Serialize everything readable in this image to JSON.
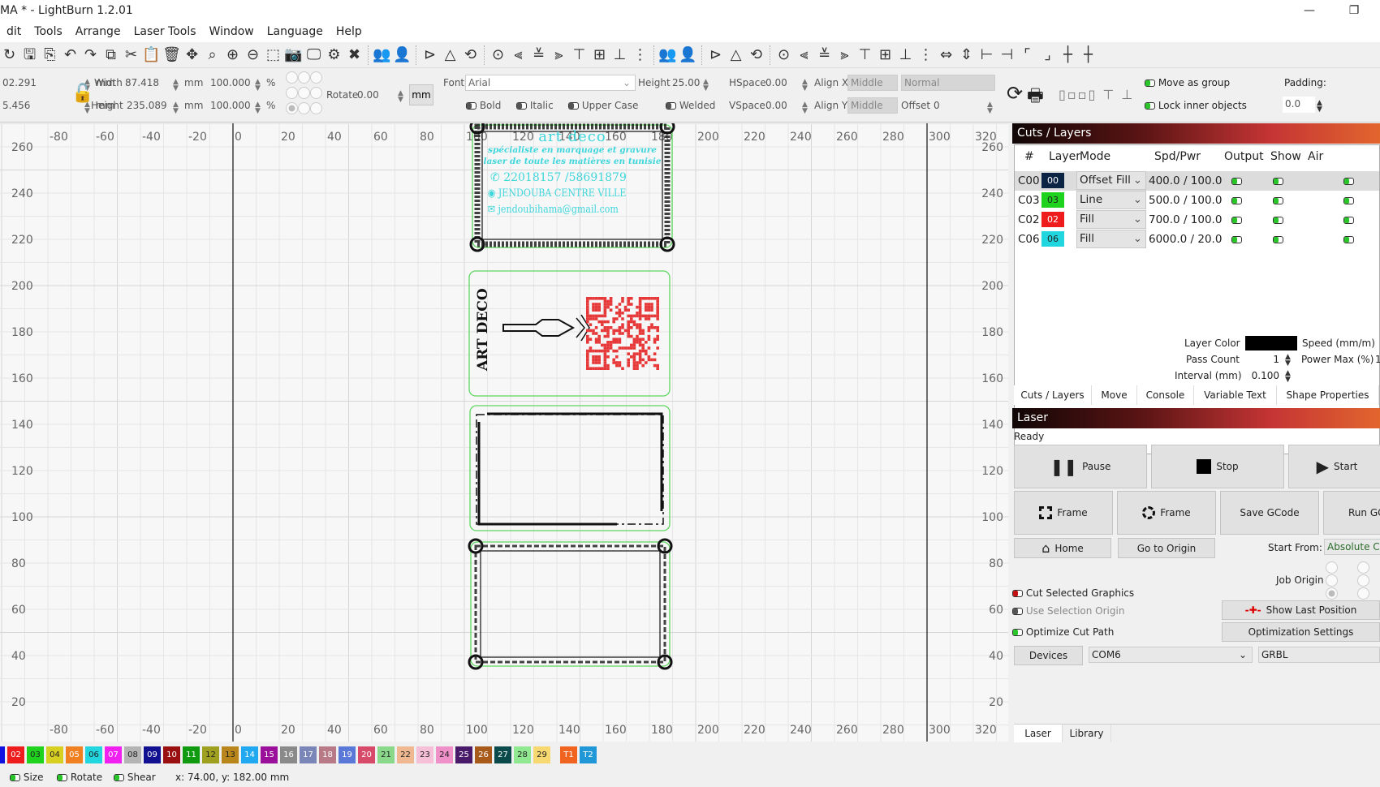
{
  "window": {
    "title": "MA * - LightBurn 1.2.01",
    "minimize_icon": "minimize-icon",
    "restore_icon": "restore-icon"
  },
  "menu": [
    "dit",
    "Tools",
    "Arrange",
    "Laser Tools",
    "Window",
    "Language",
    "Help"
  ],
  "toolbar_icons": [
    "open-icon",
    "save-icon",
    "import-icon",
    "undo-icon",
    "redo-icon",
    "copy-icon",
    "cut-icon",
    "paste-icon",
    "delete-icon",
    "move-icon",
    "zoom-selection-icon",
    "zoom-in-icon",
    "zoom-out-icon",
    "frame-selection-icon",
    "camera-icon",
    "monitor-icon",
    "settings-icon",
    "tools-icon",
    "|",
    "group-icon",
    "ungroup-icon",
    "|",
    "mirror-h-icon",
    "mirror-v-icon",
    "rotate-icon",
    "|",
    "center-icon",
    "align-left-icon",
    "align-hcenter-icon",
    "align-right-icon",
    "align-top-icon",
    "align-vcenter-icon",
    "align-bottom-icon",
    "distribute-icon",
    "|",
    "group2-icon",
    "ungroup2-icon",
    "|",
    "mirror-h2-icon",
    "mirror-v2-icon",
    "rotate2-icon",
    "|",
    "center2-icon",
    "align-left2-icon",
    "align-hcenter2-icon",
    "align-right2-icon",
    "align-top2-icon",
    "align-vcenter2-icon",
    "align-bottom2-icon",
    "distribute2-icon",
    "space-h-icon",
    "space-v-icon",
    "dock-h-icon",
    "dock-v-icon",
    "corner-tl-icon",
    "corner-br-icon",
    "cross-icon",
    "cross2-icon"
  ],
  "props": {
    "x_value": "02.291",
    "y_value": "5.456",
    "unit": "mm",
    "width_label": "Width",
    "width_value": "87.418",
    "height_label": "Height",
    "height_value": "235.089",
    "scale_w": "100.000",
    "scale_h": "100.000",
    "percent": "%",
    "rotate_label": "Rotate",
    "rotate_value": "0.00",
    "mm_button": "mm",
    "font_label": "Font",
    "font_value": "Arial",
    "text_height_label": "Height",
    "text_height_value": "25.00",
    "hspace_label": "HSpace",
    "hspace_value": "0.00",
    "vspace_label": "VSpace",
    "vspace_value": "0.00",
    "alignx_label": "Align X",
    "alignx_value": "Middle",
    "aligny_label": "Align Y",
    "aligny_value": "Middle",
    "normal_value": "Normal",
    "offset_label": "Offset",
    "offset_value": "0",
    "bold": "Bold",
    "italic": "Italic",
    "upper_case": "Upper Case",
    "welded": "Welded",
    "move_as_group": "Move as group",
    "lock_inner": "Lock inner objects",
    "padding_label": "Padding:",
    "padding_value": "0.0"
  },
  "rulers": {
    "x_ticks": [
      -80,
      -60,
      -40,
      -20,
      0,
      20,
      40,
      60,
      80,
      100,
      120,
      140,
      160,
      180,
      200,
      220,
      240,
      260,
      280,
      300,
      320
    ],
    "y_ticks": [
      260,
      240,
      220,
      200,
      180,
      160,
      140,
      120,
      100,
      80,
      60,
      40,
      20
    ]
  },
  "design": {
    "card1": {
      "title": "art deco",
      "line1": "spécialiste en marquage et gravure",
      "line2": "laser de toute les matières en tunisie",
      "phone": "22018157  /58691879",
      "address": "JENDOUBA CENTRE VILLE",
      "email": "jendoubihama@gmail.com"
    },
    "card2": {
      "brand": "ART DECO"
    }
  },
  "cuts_layers": {
    "title": "Cuts / Layers",
    "columns": [
      "#",
      "Layer",
      "Mode",
      "Spd/Pwr",
      "Output",
      "Show",
      "Air"
    ],
    "rows": [
      {
        "id": "C00",
        "layer": "00",
        "color": "#0c2444",
        "mode": "Offset Fill",
        "spdpwr": "400.0 / 100.0",
        "output": true,
        "show": true,
        "air": true
      },
      {
        "id": "C03",
        "layer": "03",
        "color": "#1ed21e",
        "mode": "Line",
        "spdpwr": "500.0 / 100.0",
        "output": true,
        "show": true,
        "air": true
      },
      {
        "id": "C02",
        "layer": "02",
        "color": "#ee1c1c",
        "mode": "Fill",
        "spdpwr": "700.0 / 100.0",
        "output": true,
        "show": true,
        "air": true
      },
      {
        "id": "C06",
        "layer": "06",
        "color": "#22d6e0",
        "mode": "Fill",
        "spdpwr": "6000.0 / 20.0",
        "output": true,
        "show": true,
        "air": true
      }
    ],
    "layer_color_label": "Layer Color",
    "pass_count_label": "Pass Count",
    "pass_count": "1",
    "interval_label": "Interval (mm)",
    "interval": "0.100",
    "speed_label": "Speed (mm/m)",
    "power_max_label": "Power Max (%)",
    "power_max": "1",
    "tabs": [
      "Cuts / Layers",
      "Move",
      "Console",
      "Variable Text",
      "Shape Properties"
    ]
  },
  "laser": {
    "title": "Laser",
    "status": "Ready",
    "pause": "Pause",
    "stop": "Stop",
    "start": "Start",
    "frame1": "Frame",
    "frame2": "Frame",
    "save_gcode": "Save GCode",
    "run_gcode": "Run GC",
    "home": "Home",
    "go_to_origin": "Go to Origin",
    "start_from_label": "Start From:",
    "start_from_value": "Absolute Co",
    "job_origin_label": "Job Origin",
    "job_origin_selected": "bottom-left",
    "cut_selected": "Cut Selected Graphics",
    "use_selection_origin": "Use Selection Origin",
    "optimize_cut_path": "Optimize Cut Path",
    "show_last_position": "Show Last Position",
    "optimization_settings": "Optimization Settings",
    "devices": "Devices",
    "port": "COM6",
    "device_type": "GRBL",
    "tabs": [
      "Laser",
      "Library"
    ]
  },
  "palette": [
    {
      "l": "02",
      "c": "#ee1c1c"
    },
    {
      "l": "03",
      "c": "#1ed21e"
    },
    {
      "l": "04",
      "c": "#d8d020"
    },
    {
      "l": "05",
      "c": "#f08020"
    },
    {
      "l": "06",
      "c": "#22d6e0"
    },
    {
      "l": "07",
      "c": "#f020f0"
    },
    {
      "l": "08",
      "c": "#b4b4b4"
    },
    {
      "l": "09",
      "c": "#101090"
    },
    {
      "l": "10",
      "c": "#9a1010"
    },
    {
      "l": "11",
      "c": "#109a10"
    },
    {
      "l": "12",
      "c": "#a0a020"
    },
    {
      "l": "13",
      "c": "#b8861a"
    },
    {
      "l": "14",
      "c": "#20a8f0"
    },
    {
      "l": "15",
      "c": "#9a109a"
    },
    {
      "l": "16",
      "c": "#8a8a8a"
    },
    {
      "l": "17",
      "c": "#7a86b8"
    },
    {
      "l": "18",
      "c": "#b87a86"
    },
    {
      "l": "19",
      "c": "#5a78d8"
    },
    {
      "l": "20",
      "c": "#d84a6a"
    },
    {
      "l": "21",
      "c": "#8ad88a"
    },
    {
      "l": "22",
      "c": "#f0b890"
    },
    {
      "l": "23",
      "c": "#f6c0d8"
    },
    {
      "l": "24",
      "c": "#f090c8"
    },
    {
      "l": "25",
      "c": "#4a1a6a"
    },
    {
      "l": "26",
      "c": "#a85a1a"
    },
    {
      "l": "27",
      "c": "#0a4a4a"
    },
    {
      "l": "28",
      "c": "#90e890"
    },
    {
      "l": "29",
      "c": "#f8d870"
    },
    {
      "l": "T1",
      "c": "#f06420"
    },
    {
      "l": "T2",
      "c": "#2098d8"
    }
  ],
  "status": {
    "size": "Size",
    "rotate": "Rotate",
    "shear": "Shear",
    "coords": "x: 74.00, y: 182.00 mm"
  }
}
